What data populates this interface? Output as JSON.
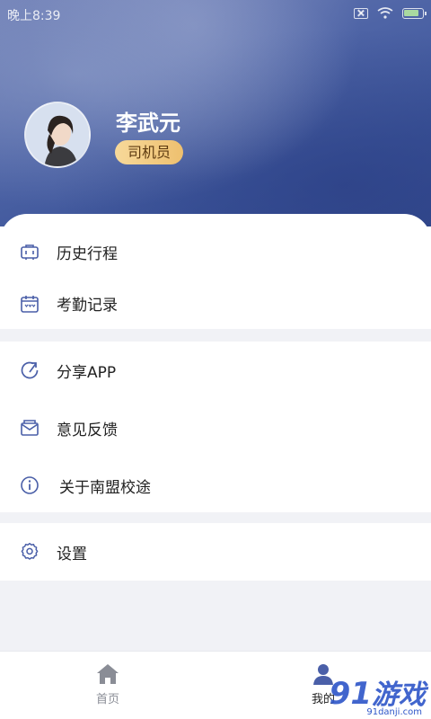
{
  "status_bar": {
    "time": "晚上8:39"
  },
  "profile": {
    "name": "李武元",
    "role": "司机员",
    "avatar_icon": "avatar-photo"
  },
  "menu": {
    "group1": [
      {
        "label": "历史行程",
        "icon": "trips-history-icon"
      },
      {
        "label": "考勤记录",
        "icon": "calendar-icon"
      }
    ],
    "group2": [
      {
        "label": "分享APP",
        "icon": "share-refresh-icon"
      },
      {
        "label": "意见反馈",
        "icon": "mail-feedback-icon"
      },
      {
        "label": "关于南盟校途",
        "icon": "info-icon"
      }
    ],
    "group3": [
      {
        "label": "设置",
        "icon": "gear-icon"
      }
    ]
  },
  "bottom_nav": {
    "home_label": "首页",
    "mine_label": "我的"
  },
  "watermark": {
    "text": "游戏",
    "sub": "91danji.com"
  },
  "colors": {
    "header": "#4e64a6",
    "badge": "#eec06f",
    "icon_stroke": "#4a5fa8"
  }
}
